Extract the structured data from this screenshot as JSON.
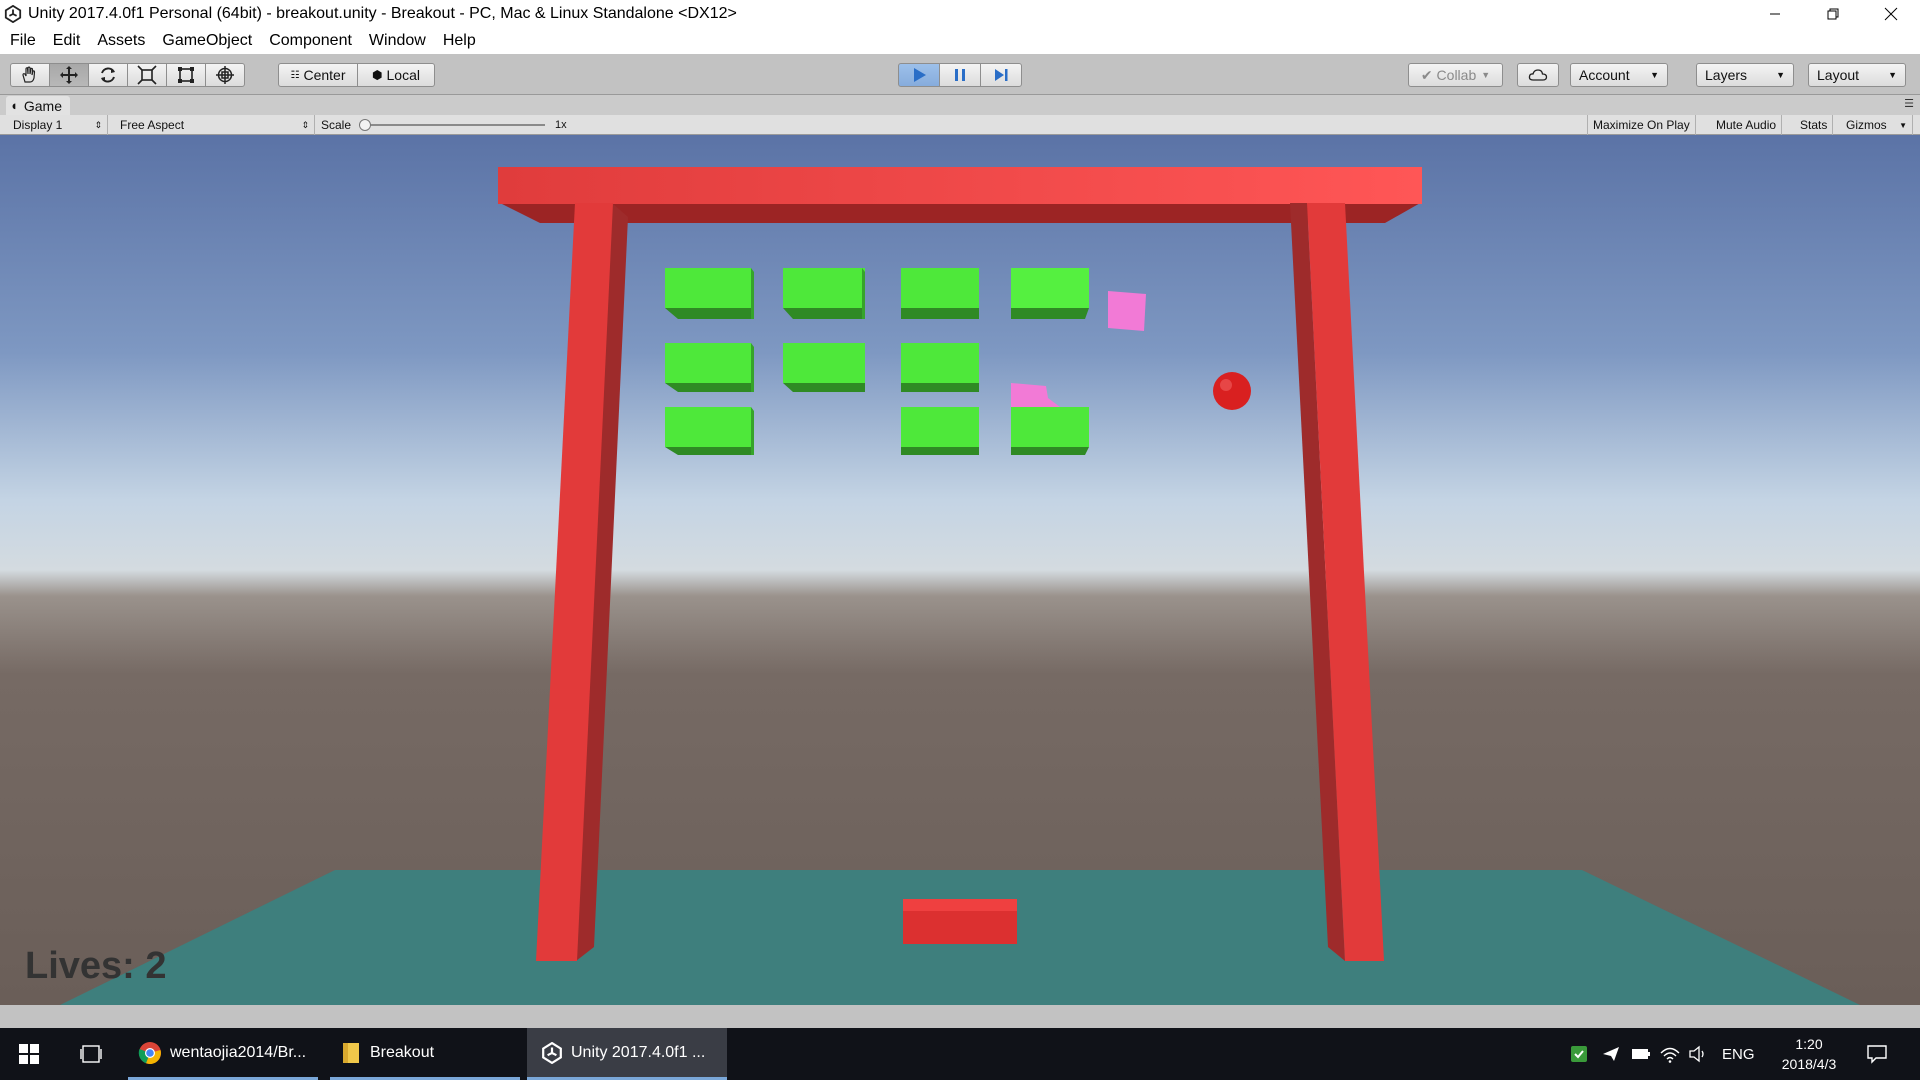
{
  "window": {
    "title": "Unity 2017.4.0f1 Personal (64bit) - breakout.unity - Breakout - PC, Mac & Linux Standalone <DX12>"
  },
  "menu": [
    "File",
    "Edit",
    "Assets",
    "GameObject",
    "Component",
    "Window",
    "Help"
  ],
  "toolbar": {
    "tools": [
      "hand-icon",
      "move-icon",
      "rotate-icon",
      "scale-icon",
      "rect-icon",
      "transform-icon"
    ],
    "pivot_center": "Center",
    "pivot_local": "Local",
    "collab": "Collab",
    "account": "Account",
    "layers": "Layers",
    "layout": "Layout",
    "accent": "#2a6ec7"
  },
  "game_panel": {
    "tab_label": "Game",
    "display": "Display 1",
    "aspect": "Free Aspect",
    "scale_label": "Scale",
    "scale_value": "1x",
    "maximize": "Maximize On Play",
    "mute": "Mute Audio",
    "stats": "Stats",
    "gizmos": "Gizmos"
  },
  "scene": {
    "lives_text": "Lives: 2",
    "frame_color": "#e84040",
    "brick_color": "#4ee83a",
    "floor_color": "#3e7f7d",
    "ball_color": "#e02424",
    "debris_color": "#f27ad6"
  },
  "taskbar": {
    "items": [
      {
        "label": "wentaojia2014/Br...",
        "icon": "chrome-icon"
      },
      {
        "label": "Breakout",
        "icon": "folder-icon"
      },
      {
        "label": "Unity 2017.4.0f1 ...",
        "icon": "unity-icon"
      }
    ],
    "lang": "ENG",
    "time": "1:20",
    "date": "2018/4/3"
  }
}
